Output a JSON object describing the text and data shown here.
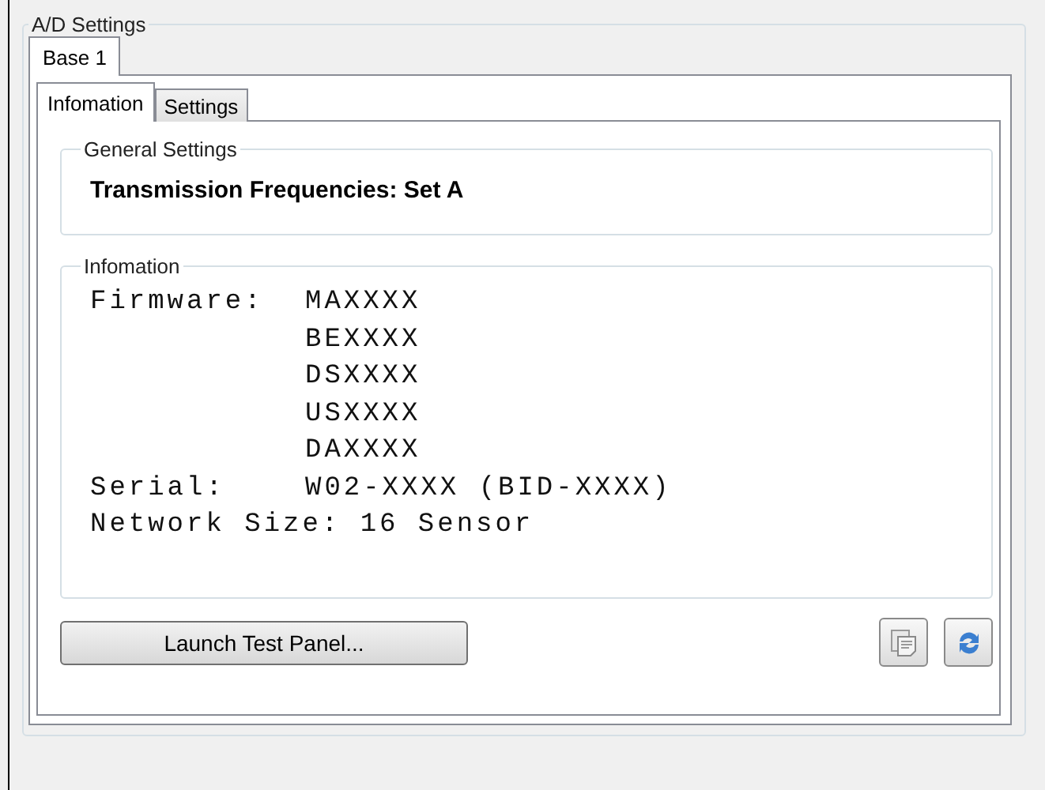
{
  "group": {
    "title": "A/D Settings"
  },
  "outer_tabs": [
    {
      "label": "Base 1",
      "selected": true
    }
  ],
  "inner_tabs": [
    {
      "label": "Infomation",
      "selected": true
    },
    {
      "label": "Settings",
      "selected": false
    }
  ],
  "general_settings": {
    "title": "General Settings",
    "text": "Transmission Frequencies: Set A"
  },
  "information": {
    "title": "Infomation",
    "lines": [
      {
        "kind": "pair",
        "label": "Firmware:",
        "value": "MAXXXX"
      },
      {
        "kind": "pair",
        "value": "BEXXXX"
      },
      {
        "kind": "pair",
        "value": "DSXXXX"
      },
      {
        "kind": "pair",
        "value": "USXXXX"
      },
      {
        "kind": "pair",
        "value": "DAXXXX"
      },
      {
        "kind": "pair",
        "label": "Serial:",
        "value": "W02-XXXX (BID-XXXX)"
      },
      {
        "kind": "full",
        "text": "Network Size: 16 Sensor"
      }
    ]
  },
  "buttons": {
    "launch": "Launch Test Panel..."
  }
}
